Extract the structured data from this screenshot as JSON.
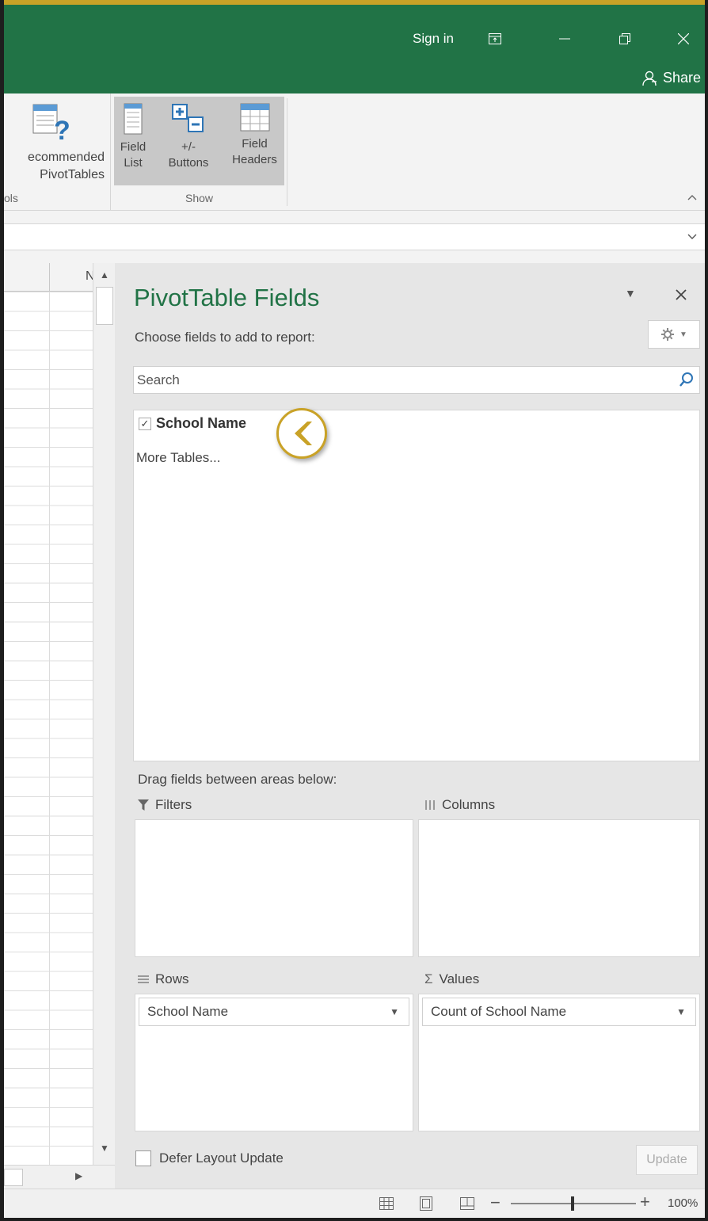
{
  "titlebar": {
    "sign_in": "Sign in",
    "share": "Share",
    "background_color": "#217346"
  },
  "ribbon": {
    "recommended_label_line1": "ecommended",
    "recommended_label_line2": "PivotTables",
    "tools_group_label": "ols",
    "show_group_label": "Show",
    "field_list_line1": "Field",
    "field_list_line2": "List",
    "buttons_line1": "+/-",
    "buttons_line2": "Buttons",
    "field_headers_line1": "Field",
    "field_headers_line2": "Headers"
  },
  "sheet": {
    "column_header_partial": "N"
  },
  "pane": {
    "title": "PivotTable Fields",
    "choose_label": "Choose fields to add to report:",
    "search_placeholder": "Search",
    "fields": [
      {
        "label": "School Name",
        "checked": true
      }
    ],
    "more_tables": "More Tables...",
    "drag_label": "Drag fields between areas below:",
    "areas": {
      "filters": {
        "label": "Filters",
        "items": []
      },
      "columns": {
        "label": "Columns",
        "items": []
      },
      "rows": {
        "label": "Rows",
        "items": [
          "School Name"
        ]
      },
      "values": {
        "label": "Values",
        "items": [
          "Count of School Name"
        ]
      }
    },
    "defer_label": "Defer Layout Update",
    "defer_checked": false,
    "update_label": "Update"
  },
  "statusbar": {
    "zoom": "100%"
  },
  "colors": {
    "accent_green": "#217346",
    "callout_gold": "#c9a227"
  }
}
